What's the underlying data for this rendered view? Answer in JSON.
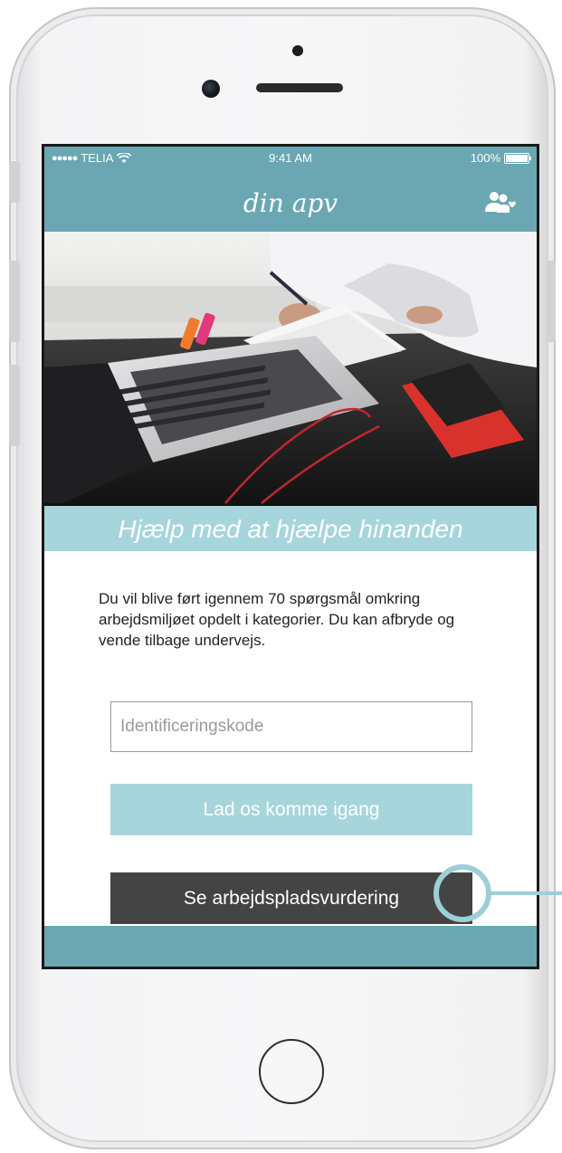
{
  "status_bar": {
    "carrier": "TELIA",
    "time": "9:41 AM",
    "battery": "100%"
  },
  "nav": {
    "title": "din apv",
    "icon": "users-heart-icon"
  },
  "hero": {
    "icon": "laptop-desk-photo"
  },
  "headline": "Hjælp med at hjælpe hinanden",
  "intro": "Du vil blive ført igennem 70 spørgsmål omkring arbejdsmiljøet opdelt i kategorier. Du kan afbryde og vende tilbage undervejs.",
  "code_input": {
    "placeholder": "Identificeringskode",
    "value": ""
  },
  "buttons": {
    "start": "Lad os komme igang",
    "view": "Se arbejdspladsvurdering"
  },
  "colors": {
    "primary": "#6aa7b2",
    "accent_light": "#a6d5dc",
    "dark_button": "#444444"
  }
}
